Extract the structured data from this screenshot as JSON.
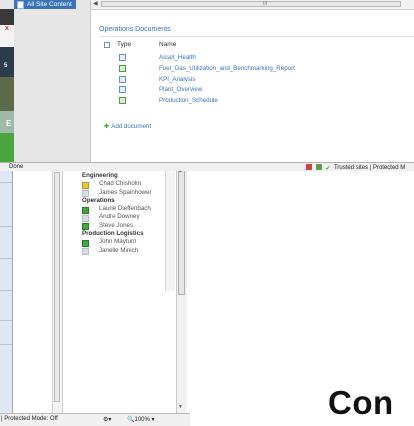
{
  "sharepoint": {
    "sidebar_link": "All Site Content",
    "section_title": "Operations Documents",
    "columns": {
      "type": "Type",
      "name": "Name"
    },
    "documents": [
      {
        "name": "Asset_Health",
        "icon": "page-icon"
      },
      {
        "name": "Fuel_Gas_Utilization_and_Benchmarking_Report",
        "icon": "excel-icon"
      },
      {
        "name": "KPI_Analysis",
        "icon": "page-icon"
      },
      {
        "name": "Plant_Overview",
        "icon": "page-icon"
      },
      {
        "name": "Production_Schedule",
        "icon": "excel-icon"
      }
    ],
    "add_document": "Add document",
    "scroll_grip": "III"
  },
  "ie_front_status": {
    "left": "Done",
    "zone": "Trusted sites | Protected M"
  },
  "org_chart": {
    "rows": [
      {
        "kind": "group",
        "label": "Engineering"
      },
      {
        "kind": "person",
        "label": "Chad Chisholm",
        "pic": "yellow"
      },
      {
        "kind": "person",
        "label": "James Spainhower",
        "pic": "grey"
      },
      {
        "kind": "group",
        "label": "Operations"
      },
      {
        "kind": "person",
        "label": "Laurie Dieffenbach",
        "pic": "green"
      },
      {
        "kind": "person",
        "label": "Andre Downey",
        "pic": "grey"
      },
      {
        "kind": "person",
        "label": "Steve Jones",
        "pic": "green"
      },
      {
        "kind": "group",
        "label": "Production Logistics"
      },
      {
        "kind": "person",
        "label": "John Mayturn",
        "pic": "green"
      },
      {
        "kind": "person",
        "label": "Janelle Minich",
        "pic": "grey"
      }
    ]
  },
  "ie_back_status": {
    "mode": "| Protected Mode: Off",
    "zoom": "100%"
  },
  "slide": {
    "big_text": "Con"
  },
  "desktop_peek": {
    "glyph_x": "x",
    "glyph_5": "5",
    "glyph_e": "E"
  }
}
